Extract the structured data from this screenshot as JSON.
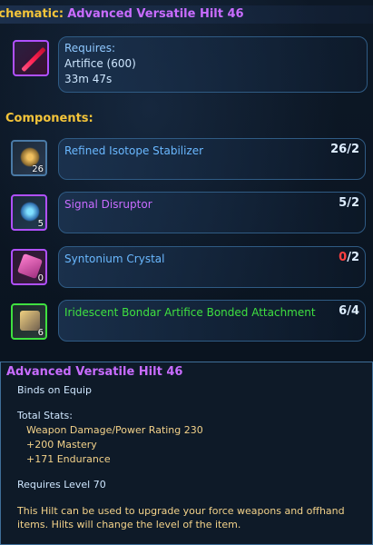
{
  "schematic": {
    "label": "Schematic:",
    "name": "Advanced Versatile Hilt 46"
  },
  "requirements": {
    "heading": "Requires:",
    "skill": "Artifice (600)",
    "time": "33m 47s"
  },
  "components": {
    "heading": "Components:",
    "items": [
      {
        "name": "Refined Isotope Stabilizer",
        "stack": "26",
        "have": "26",
        "need": "2",
        "color": "#6ab8ff",
        "icon": "isotope-stabilizer-icon",
        "border": "#4a7aa6"
      },
      {
        "name": "Signal Disruptor",
        "stack": "5",
        "have": "5",
        "need": "2",
        "color": "#c86cff",
        "icon": "signal-disruptor-icon",
        "border": "#b050ff"
      },
      {
        "name": "Syntonium Crystal",
        "stack": "0",
        "have": "0",
        "need": "2",
        "color": "#6ab8ff",
        "icon": "syntonium-crystal-icon",
        "border": "#b050ff"
      },
      {
        "name": "Iridescent Bondar Artifice Bonded Attachment",
        "stack": "6",
        "have": "6",
        "need": "4",
        "color": "#3fe040",
        "icon": "bonded-attachment-icon",
        "border": "#3fe040"
      }
    ]
  },
  "tooltip": {
    "title": "Advanced Versatile Hilt 46",
    "binds": "Binds on Equip",
    "stats_heading": "Total Stats:",
    "stats": [
      "Weapon Damage/Power Rating 230",
      "+200 Mastery",
      "+171 Endurance"
    ],
    "requires_level": "Requires Level 70",
    "description": "This Hilt can be used to upgrade your force weapons and offhand items. Hilts will change the level of the item."
  }
}
